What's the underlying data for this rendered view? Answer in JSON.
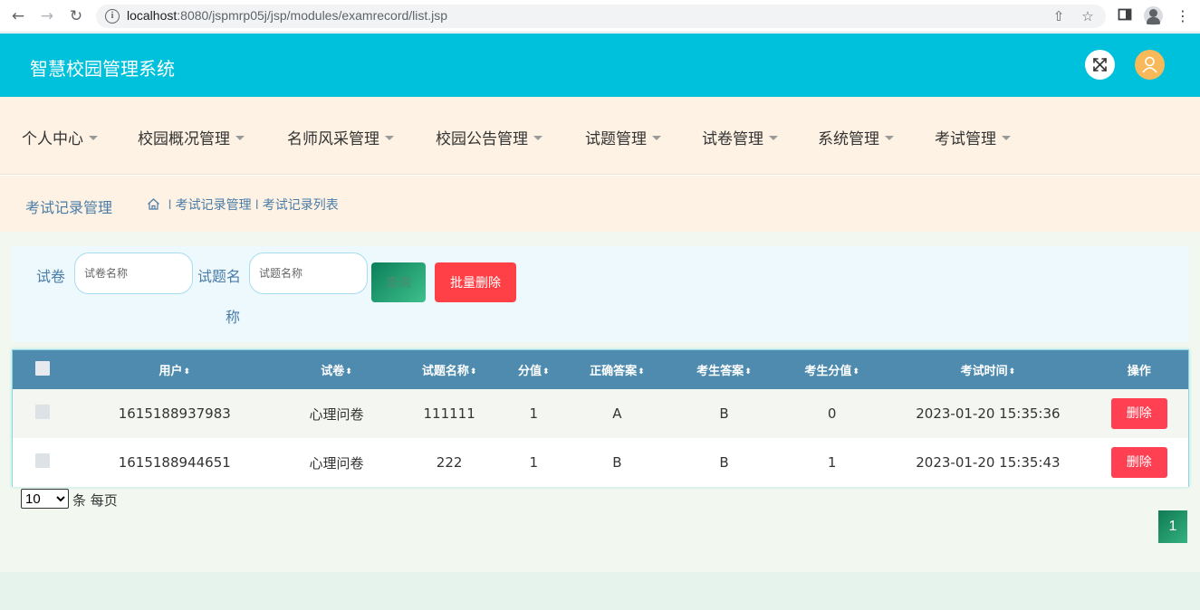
{
  "browser": {
    "url_host": "localhost",
    "url_rest": ":8080/jspmrp05j/jsp/modules/examrecord/list.jsp"
  },
  "header": {
    "title": "智慧校园管理系统"
  },
  "menu": {
    "items": [
      {
        "label": "个人中心"
      },
      {
        "label": "校园概况管理"
      },
      {
        "label": "名师风采管理"
      },
      {
        "label": "校园公告管理"
      },
      {
        "label": "试题管理"
      },
      {
        "label": "试卷管理"
      },
      {
        "label": "系统管理"
      },
      {
        "label": "考试管理"
      }
    ]
  },
  "breadcrumb": {
    "title": "考试记录管理",
    "sep": "I",
    "level1": "考试记录管理",
    "level2": "考试记录列表"
  },
  "search": {
    "paper_label": "试卷",
    "paper_placeholder": "试卷名称",
    "question_label_1": "试题名",
    "question_label_2": "称",
    "question_placeholder": "试题名称",
    "query_button": "查询",
    "batch_delete_button": "批量删除"
  },
  "table": {
    "columns": [
      "用户",
      "试卷",
      "试题名称",
      "分值",
      "正确答案",
      "考生答案",
      "考生分值",
      "考试时间",
      "操作"
    ],
    "sort_icon": "⬍",
    "rows": [
      {
        "user": "1615188937983",
        "paper": "心理问卷",
        "question": "111111",
        "score": "1",
        "correct": "A",
        "answer": "B",
        "got": "0",
        "time": "2023-01-20 15:35:36",
        "action": "删除"
      },
      {
        "user": "1615188944651",
        "paper": "心理问卷",
        "question": "222",
        "score": "1",
        "correct": "B",
        "answer": "B",
        "got": "1",
        "time": "2023-01-20 15:35:43",
        "action": "删除"
      }
    ]
  },
  "pagination": {
    "page_size_options": [
      "10"
    ],
    "page_size_selected": "10",
    "page_size_label": "条 每页",
    "current_page": "1"
  },
  "colors": {
    "header_bg": "#00c1dc",
    "menu_bg": "#fdf2e3",
    "table_header_bg": "#4e8bae",
    "delete_red": "#ff4052",
    "page_green": "#1f9a6a"
  }
}
